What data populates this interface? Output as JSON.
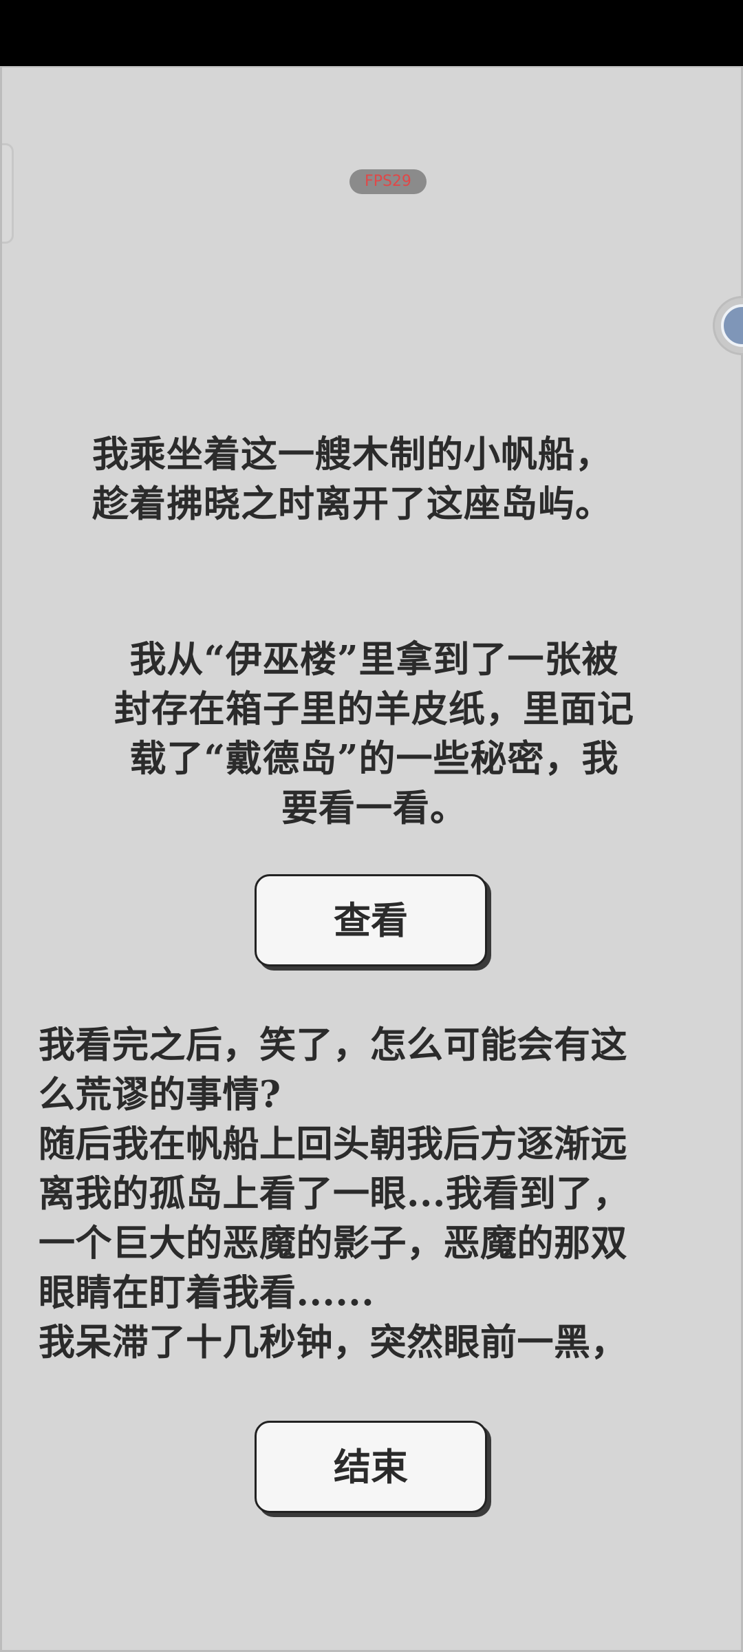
{
  "hud": {
    "fps_label": "FPS29"
  },
  "story": {
    "paragraph_1": "我乘坐着这一艘木制的小帆船，\n趁着拂晓之时离开了这座岛屿。",
    "paragraph_2": "我从“伊巫楼”里拿到了一张被\n封存在箱子里的羊皮纸，里面记\n载了“戴德岛”的一些秘密，我\n要看一看。",
    "paragraph_3": "我看完之后，笑了，怎么可能会有这\n么荒谬的事情?\n随后我在帆船上回头朝我后方逐渐远\n离我的孤岛上看了一眼...我看到了，\n一个巨大的恶魔的影子，恶魔的那双\n眼睛在盯着我看......\n我呆滞了十几秒钟，突然眼前一黑，"
  },
  "buttons": {
    "view_label": "查看",
    "end_label": "结束"
  },
  "colors": {
    "background": "#d6d6d6",
    "text": "#2b2b2b",
    "fps_text": "#e04848",
    "button_fill": "#f6f6f6"
  }
}
